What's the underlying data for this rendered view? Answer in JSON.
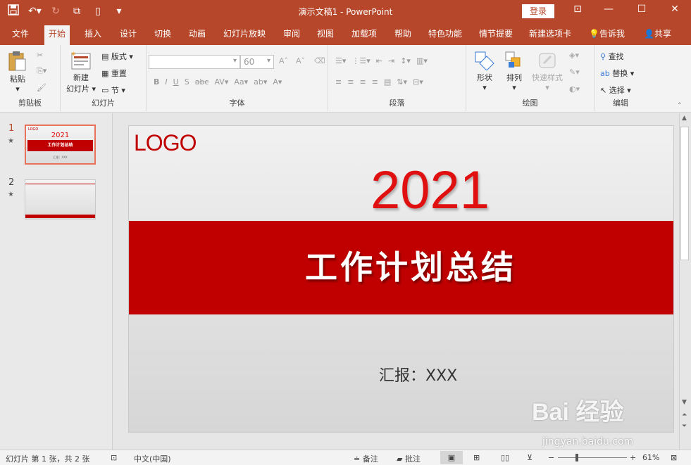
{
  "window": {
    "title": "演示文稿1  -  PowerPoint",
    "login": "登录"
  },
  "qat": {
    "save_icon": "save-icon",
    "undo_icon": "undo-icon",
    "redo_icon": "redo-icon",
    "present_icon": "present-icon",
    "new_icon": "new-doc-icon",
    "more_icon": "customize-icon"
  },
  "tabs": [
    "文件",
    "开始",
    "插入",
    "设计",
    "切换",
    "动画",
    "幻灯片放映",
    "审阅",
    "视图",
    "加载项",
    "帮助",
    "特色功能",
    "情节提要",
    "新建选项卡"
  ],
  "tell_me": "告诉我",
  "share": "共享",
  "ribbon": {
    "clipboard": {
      "paste": "粘贴",
      "label": "剪贴板"
    },
    "slides": {
      "new_slide": "新建",
      "new_slide2": "幻灯片",
      "layout": "版式",
      "reset": "重置",
      "section": "节",
      "label": "幻灯片"
    },
    "font": {
      "size": "60",
      "label": "字体"
    },
    "paragraph": {
      "label": "段落"
    },
    "drawing": {
      "shapes": "形状",
      "arrange": "排列",
      "quick_styles": "快速样式",
      "label": "绘图"
    },
    "editing": {
      "find": "查找",
      "replace": "替换",
      "select": "选择",
      "label": "编辑"
    }
  },
  "thumbnails": [
    {
      "num": "1",
      "star": "★",
      "logo": "LOGO",
      "year": "2021",
      "title": "工作计划总结",
      "sub": "汇报：XXX"
    },
    {
      "num": "2",
      "star": "★"
    }
  ],
  "slide": {
    "logo": "LOGO",
    "year": "2021",
    "title": "工作计划总结",
    "reporter": "汇报：XXX"
  },
  "status": {
    "slide_info": "幻灯片 第 1 张，共 2 张",
    "language": "中文(中国)",
    "notes": "备注",
    "comments": "批注",
    "zoom": "61%"
  },
  "watermark": {
    "brand": "Bai 经验",
    "url": "jingyan.baidu.com"
  },
  "colors": {
    "accent": "#b7472a",
    "band": "#c00000",
    "year": "#e01010"
  }
}
